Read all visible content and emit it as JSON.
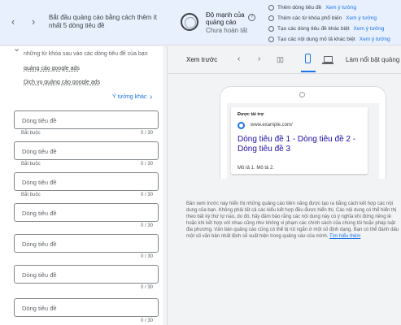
{
  "topbar": {
    "prompt": "Bắt đầu quảng cáo bằng cách thêm ít nhất 5 dòng tiêu đề",
    "strength_label": "Độ mạnh của quảng cáo",
    "strength_status": "Chưa hoàn tất",
    "help_icon": "help-icon",
    "suggestions": [
      {
        "text": "Thêm dòng tiêu đề",
        "link": "Xem ý tưởng"
      },
      {
        "text": "Thêm các từ khóa phổ biến",
        "link": "Xem ý tưởng"
      },
      {
        "text": "Tạo các dòng tiêu đề khác biệt",
        "link": "Xem ý tưởng"
      },
      {
        "text": "Tạo các nội dung mô tả khác biệt",
        "link": "Xem ý tưởng"
      }
    ]
  },
  "left": {
    "intro": "những từ khóa sau vào các dòng tiêu đề của bạn",
    "keywords": [
      "quảng cáo google ads",
      "Dịch vụ quảng cáo google ads"
    ],
    "ideas_link": "Ý tưởng khác",
    "headlines": [
      {
        "placeholder": "Dòng tiêu đề",
        "required": "Bắt buộc",
        "count": "0 / 30"
      },
      {
        "placeholder": "Dòng tiêu đề",
        "required": "Bắt buộc",
        "count": "0 / 30"
      },
      {
        "placeholder": "Dòng tiêu đề",
        "required": "Bắt buộc",
        "count": "0 / 30"
      },
      {
        "placeholder": "Dòng tiêu đề",
        "required": "",
        "count": "0 / 30"
      },
      {
        "placeholder": "Dòng tiêu đề",
        "required": "",
        "count": "0 / 30"
      },
      {
        "placeholder": "Dòng tiêu đề",
        "required": "",
        "count": "0 / 30"
      },
      {
        "placeholder": "Dòng tiêu đề",
        "required": "",
        "count": "0 / 30"
      }
    ]
  },
  "preview": {
    "title": "Xem trước",
    "highlight_label": "Làm nổi bật quảng c",
    "sponsored": "Được tài trợ",
    "display_url": "www.example.com/",
    "headline": "Dòng tiêu đề 1 - Dòng tiêu đề 2 - Dòng tiêu đề 3",
    "description": "Mô tả 1. Mô tả 2.",
    "disclaimer": "Bản xem trước này hiển thị những quảng cáo tiềm năng được tạo ra bằng cách kết hợp các nội dung của bạn. Không phải tất cả các kiểu kết hợp đều được hiển thị. Các nội dung có thể hiển thị theo bất kỳ thứ tự nào, do đó, hãy đảm bảo rằng các nội dung này có ý nghĩa khi đứng riêng lẻ hoặc khi kết hợp với nhau cũng như không vi phạm các chính sách của chúng tôi hoặc pháp luật địa phương. Văn bản quảng cáo cũng có thể bị rút ngắn ở một số định dạng. Bạn có thể đánh dấu một số văn bản nhất định sẽ xuất hiện trong quảng cáo của mình.",
    "learn_more": "Tìm hiểu thêm"
  },
  "colors": {
    "accent": "#1a73e8",
    "headline_link": "#1a0dab",
    "topbar_bg": "#e8f0fe"
  }
}
